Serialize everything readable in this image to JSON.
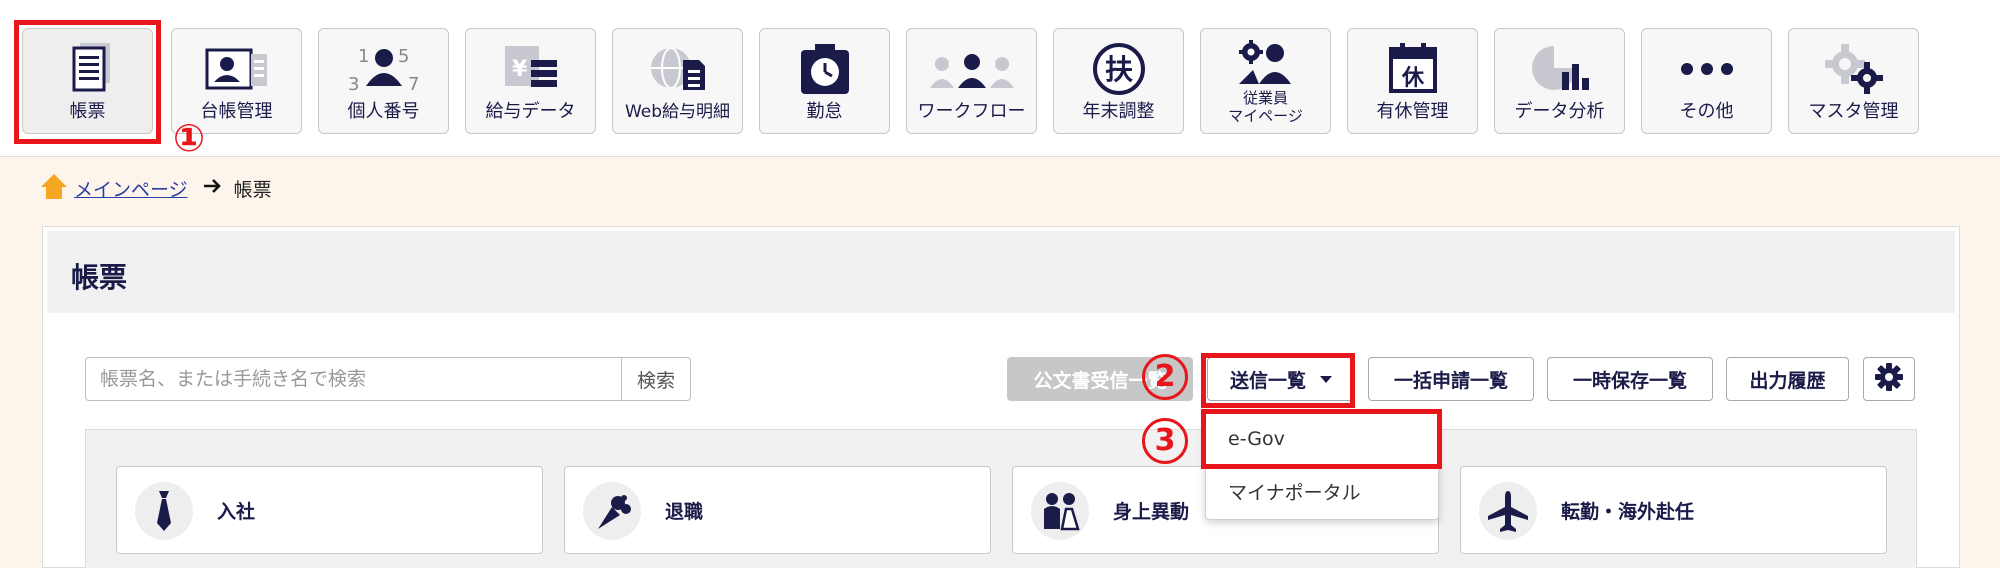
{
  "nav": {
    "items": [
      {
        "label": "帳票",
        "icon": "document-stack-icon"
      },
      {
        "label": "台帳管理",
        "icon": "id-card-icon"
      },
      {
        "label": "個人番号",
        "icon": "person-number-icon"
      },
      {
        "label": "給与データ",
        "icon": "salary-data-icon"
      },
      {
        "label": "Web給与明細",
        "icon": "web-payslip-icon"
      },
      {
        "label": "勤怠",
        "icon": "timeclock-icon"
      },
      {
        "label": "ワークフロー",
        "icon": "workflow-people-icon"
      },
      {
        "label": "年末調整",
        "icon": "fu-stamp-icon"
      },
      {
        "label1": "従業員",
        "label2": "マイページ",
        "icon": "employee-gear-icon"
      },
      {
        "label": "有休管理",
        "icon": "calendar-holiday-icon"
      },
      {
        "label": "データ分析",
        "icon": "analytics-chart-icon"
      },
      {
        "label": "その他",
        "icon": "more-dots-icon"
      },
      {
        "label": "マスタ管理",
        "icon": "gears-icon"
      }
    ],
    "holiday_char": "休",
    "fu_char": "扶",
    "num_glyphs": [
      "1",
      "5",
      "3",
      "7"
    ],
    "yen_glyph": "¥"
  },
  "annotations": {
    "step1": "①",
    "step2": "2",
    "step3": "3"
  },
  "breadcrumb": {
    "home": "メインページ",
    "current": "帳票"
  },
  "panel": {
    "title": "帳票"
  },
  "search": {
    "placeholder": "帳票名、または手続き名で検索",
    "button": "検索"
  },
  "toolbar": {
    "official_docs": "公文書受信一覧",
    "send_list": "送信一覧",
    "bulk_list": "一括申請一覧",
    "temp_list": "一時保存一覧",
    "output_history": "出力履歴"
  },
  "dropdown": {
    "items": [
      "e-Gov",
      "マイナポータル"
    ]
  },
  "categories": [
    "入社",
    "退職",
    "身上異動",
    "転勤・海外赴任"
  ],
  "colors": {
    "navy": "#1b1b4a",
    "red": "#e8151b",
    "home": "#f5a623",
    "link": "#2b3fa3"
  }
}
